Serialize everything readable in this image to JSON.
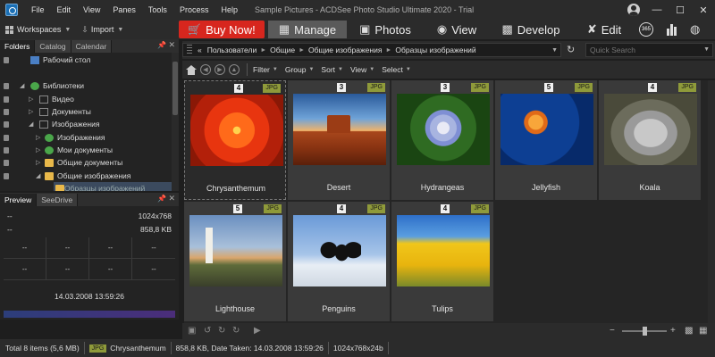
{
  "menu": [
    "File",
    "Edit",
    "View",
    "Panes",
    "Tools",
    "Process",
    "Help"
  ],
  "window_title": "Sample Pictures - ACDSee Photo Studio Ultimate 2020 - Trial",
  "toolbar": {
    "workspaces": "Workspaces",
    "import": "Import",
    "buy_now": "Buy Now!",
    "modes": [
      "Manage",
      "Photos",
      "View",
      "Develop",
      "Edit"
    ],
    "badge_365": "365"
  },
  "left_tabs": [
    "Folders",
    "Catalog",
    "Calendar"
  ],
  "tree": [
    "Рабочий стол",
    "Библиотеки",
    "Видео",
    "Документы",
    "Изображения",
    "Изображения",
    "Мои документы",
    "Общие документы",
    "Общие изображения",
    "Образцы изображений"
  ],
  "preview_tabs": [
    "Preview",
    "SeeDrive"
  ],
  "preview": {
    "dims": "1024x768",
    "size": "858,8 KB",
    "dash": "--",
    "date": "14.03.2008 13:59:26"
  },
  "address": {
    "prefix": "«",
    "path": [
      "Пользователи",
      "Общие",
      "Общие изображения",
      "Образцы изображений"
    ],
    "search_placeholder": "Quick Search"
  },
  "filterbar": [
    "Filter",
    "Group",
    "Sort",
    "View",
    "Select"
  ],
  "thumbnails": [
    {
      "name": "Chrysanthemum",
      "rating": "4",
      "format": "JPG"
    },
    {
      "name": "Desert",
      "rating": "3",
      "format": "JPG"
    },
    {
      "name": "Hydrangeas",
      "rating": "3",
      "format": "JPG"
    },
    {
      "name": "Jellyfish",
      "rating": "5",
      "format": "JPG"
    },
    {
      "name": "Koala",
      "rating": "4",
      "format": "JPG"
    },
    {
      "name": "Lighthouse",
      "rating": "5",
      "format": "JPG"
    },
    {
      "name": "Penguins",
      "rating": "4",
      "format": "JPG"
    },
    {
      "name": "Tulips",
      "rating": "4",
      "format": "JPG"
    }
  ],
  "status": {
    "total": "Total 8 items  (5,6 MB)",
    "format": "JPG",
    "file": "Chrysanthemum",
    "info": "858,8 KB, Date Taken: 14.03.2008 13:59:26",
    "dims": "1024x768x24b"
  },
  "colors": {
    "buy_now": "#d7261e",
    "format_badge": "#8f9a3a",
    "active_mode": "#5a5a5a"
  }
}
